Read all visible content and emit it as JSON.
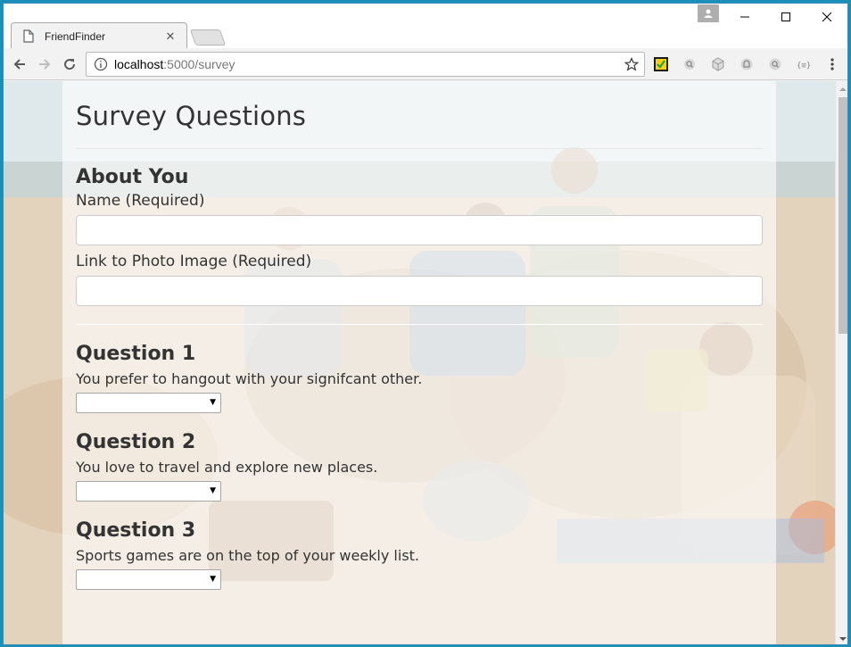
{
  "browser": {
    "tab_title": "FriendFinder",
    "url_host": "localhost",
    "url_rest": ":5000/survey",
    "icons": {
      "back": "back-arrow-icon",
      "forward": "forward-arrow-icon",
      "reload": "reload-icon",
      "info": "info-icon",
      "star": "bookmark-star-icon"
    }
  },
  "page": {
    "title": "Survey Questions",
    "about_heading": "About You",
    "name_label": "Name (Required)",
    "photo_label": "Link to Photo Image (Required)",
    "name_value": "",
    "photo_value": "",
    "questions": [
      {
        "heading": "Question 1",
        "text": "You prefer to hangout with your signifcant other.",
        "selected": ""
      },
      {
        "heading": "Question 2",
        "text": "You love to travel and explore new places.",
        "selected": ""
      },
      {
        "heading": "Question 3",
        "text": "Sports games are on the top of your weekly list.",
        "selected": ""
      }
    ]
  },
  "colors": {
    "panel_overlay": "#ffffff",
    "text": "#333333",
    "window_border": "#3a8ab4"
  }
}
